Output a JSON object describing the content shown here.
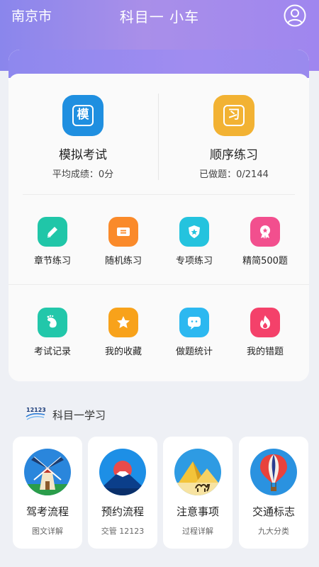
{
  "header": {
    "city": "南京市",
    "title": "科目一 小车",
    "user_icon": "user-circle-icon"
  },
  "main_actions": [
    {
      "glyph": "模",
      "label": "模拟考试",
      "sub": "平均成绩：0分",
      "color": "#1f8fe0",
      "icon": "mock-exam-icon"
    },
    {
      "glyph": "习",
      "label": "顺序练习",
      "sub": "已做题：0/2144",
      "color": "#f2b233",
      "icon": "sequential-practice-icon"
    }
  ],
  "grid_row1": [
    {
      "label": "章节练习",
      "color": "#20c6a8",
      "icon": "pencil-icon"
    },
    {
      "label": "随机练习",
      "color": "#fa8a2a",
      "icon": "ticket-icon"
    },
    {
      "label": "专项练习",
      "color": "#24c3de",
      "icon": "shield-star-icon"
    },
    {
      "label": "精简500题",
      "color": "#f24f8e",
      "icon": "ribbon-badge-icon"
    }
  ],
  "grid_row2": [
    {
      "label": "考试记录",
      "color": "#22c7aa",
      "icon": "footprint-icon"
    },
    {
      "label": "我的收藏",
      "color": "#f8a21a",
      "icon": "star-icon"
    },
    {
      "label": "做题统计",
      "color": "#2cb8f0",
      "icon": "chat-face-icon"
    },
    {
      "label": "我的错题",
      "color": "#f4416a",
      "icon": "flame-icon"
    }
  ],
  "study": {
    "logo_text": "12123",
    "title": "科目一学习",
    "cards": [
      {
        "title": "驾考流程",
        "sub": "图文详解",
        "icon": "windmill-icon"
      },
      {
        "title": "预约流程",
        "sub": "交管 12123",
        "icon": "mountain-icon"
      },
      {
        "title": "注意事项",
        "sub": "过程详解",
        "icon": "pyramid-camel-icon"
      },
      {
        "title": "交通标志",
        "sub": "九大分类",
        "icon": "hot-air-balloon-icon"
      }
    ]
  }
}
